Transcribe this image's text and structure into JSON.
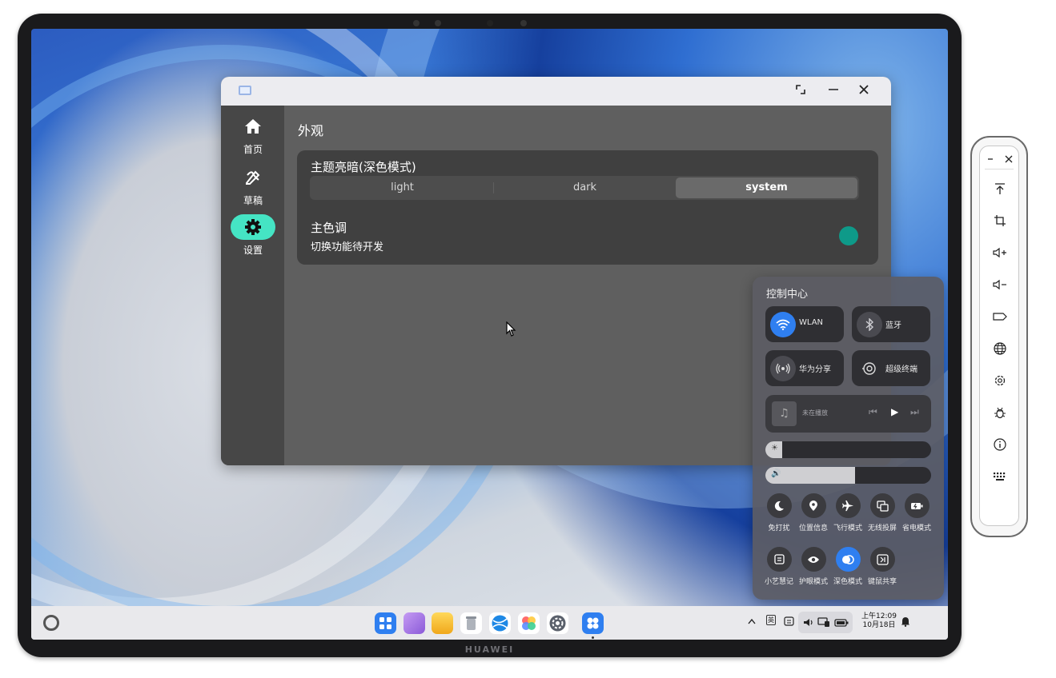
{
  "device": {
    "brand": "HUAWEI"
  },
  "app": {
    "window_buttons": {
      "restore": "⤡",
      "minimize": "—",
      "close": "✕"
    },
    "sidebar": {
      "items": [
        {
          "label": "首页",
          "icon": "home-icon",
          "active": false
        },
        {
          "label": "草稿",
          "icon": "draft-icon",
          "active": false
        },
        {
          "label": "设置",
          "icon": "gear-icon",
          "active": true
        }
      ],
      "active_color": "#45e4c4"
    },
    "page_title": "外观",
    "theme": {
      "title": "主题亮暗(深色模式)",
      "options": [
        "light",
        "dark",
        "system"
      ],
      "selected": "system"
    },
    "accent": {
      "title": "主色调",
      "subtitle": "切换功能待开发",
      "color": "#0e9a89"
    }
  },
  "control_center": {
    "title": "控制中心",
    "tiles": [
      {
        "label": "WLAN",
        "icon": "wifi-icon",
        "on": true
      },
      {
        "label": "蓝牙",
        "icon": "bluetooth-icon",
        "on": false
      },
      {
        "label": "华为分享",
        "icon": "share-icon",
        "on": false
      },
      {
        "label": "超级终端",
        "icon": "super-device-icon",
        "on": false
      }
    ],
    "media": {
      "status": "未在播放",
      "icons": [
        "music-note-icon",
        "previous-icon",
        "play-icon",
        "next-icon"
      ]
    },
    "brightness": {
      "icon": "sun-icon",
      "level": 0.1
    },
    "volume": {
      "icon": "speaker-icon",
      "level": 0.54
    },
    "quick_row1": [
      {
        "label": "免打扰",
        "icon": "moon-icon",
        "on": false
      },
      {
        "label": "位置信息",
        "icon": "location-icon",
        "on": false
      },
      {
        "label": "飞行模式",
        "icon": "airplane-icon",
        "on": false
      },
      {
        "label": "无线投屏",
        "icon": "cast-icon",
        "on": false
      },
      {
        "label": "省电模式",
        "icon": "battery-saver-icon",
        "on": false
      }
    ],
    "quick_row2": [
      {
        "label": "小艺慧记",
        "icon": "note-icon",
        "on": false
      },
      {
        "label": "护眼模式",
        "icon": "eye-icon",
        "on": false
      },
      {
        "label": "深色模式",
        "icon": "dark-mode-icon",
        "on": true
      },
      {
        "label": "键鼠共享",
        "icon": "keyboard-mouse-icon",
        "on": false
      }
    ],
    "accent": "#2f7ff0"
  },
  "taskbar": {
    "dock": [
      {
        "name": "app-grid-icon",
        "color": "#2f7ff0"
      },
      {
        "name": "multitask-icon",
        "color": "#a071e0"
      },
      {
        "name": "files-icon",
        "color": "#f5bf2c"
      },
      {
        "name": "trash-icon",
        "color": "#b8bcc4"
      },
      {
        "name": "browser-icon",
        "color": "#1e88e5"
      },
      {
        "name": "gallery-icon",
        "color": "#ff7a59"
      },
      {
        "name": "settings-icon",
        "color": "#555b66"
      },
      {
        "name": "app-icon",
        "color": "#2f7ff0"
      }
    ],
    "tray": {
      "ime": "英",
      "time_line1": "上午12:09",
      "time_line2": "10月18日"
    }
  },
  "side_toolbar": {
    "icons": [
      "minimize-icon",
      "close-icon",
      "top-icon",
      "crop-icon",
      "volume-up-icon",
      "volume-down-icon",
      "tag-icon",
      "globe-icon",
      "settings-icon",
      "bug-icon",
      "info-icon",
      "keyboard-icon"
    ]
  }
}
